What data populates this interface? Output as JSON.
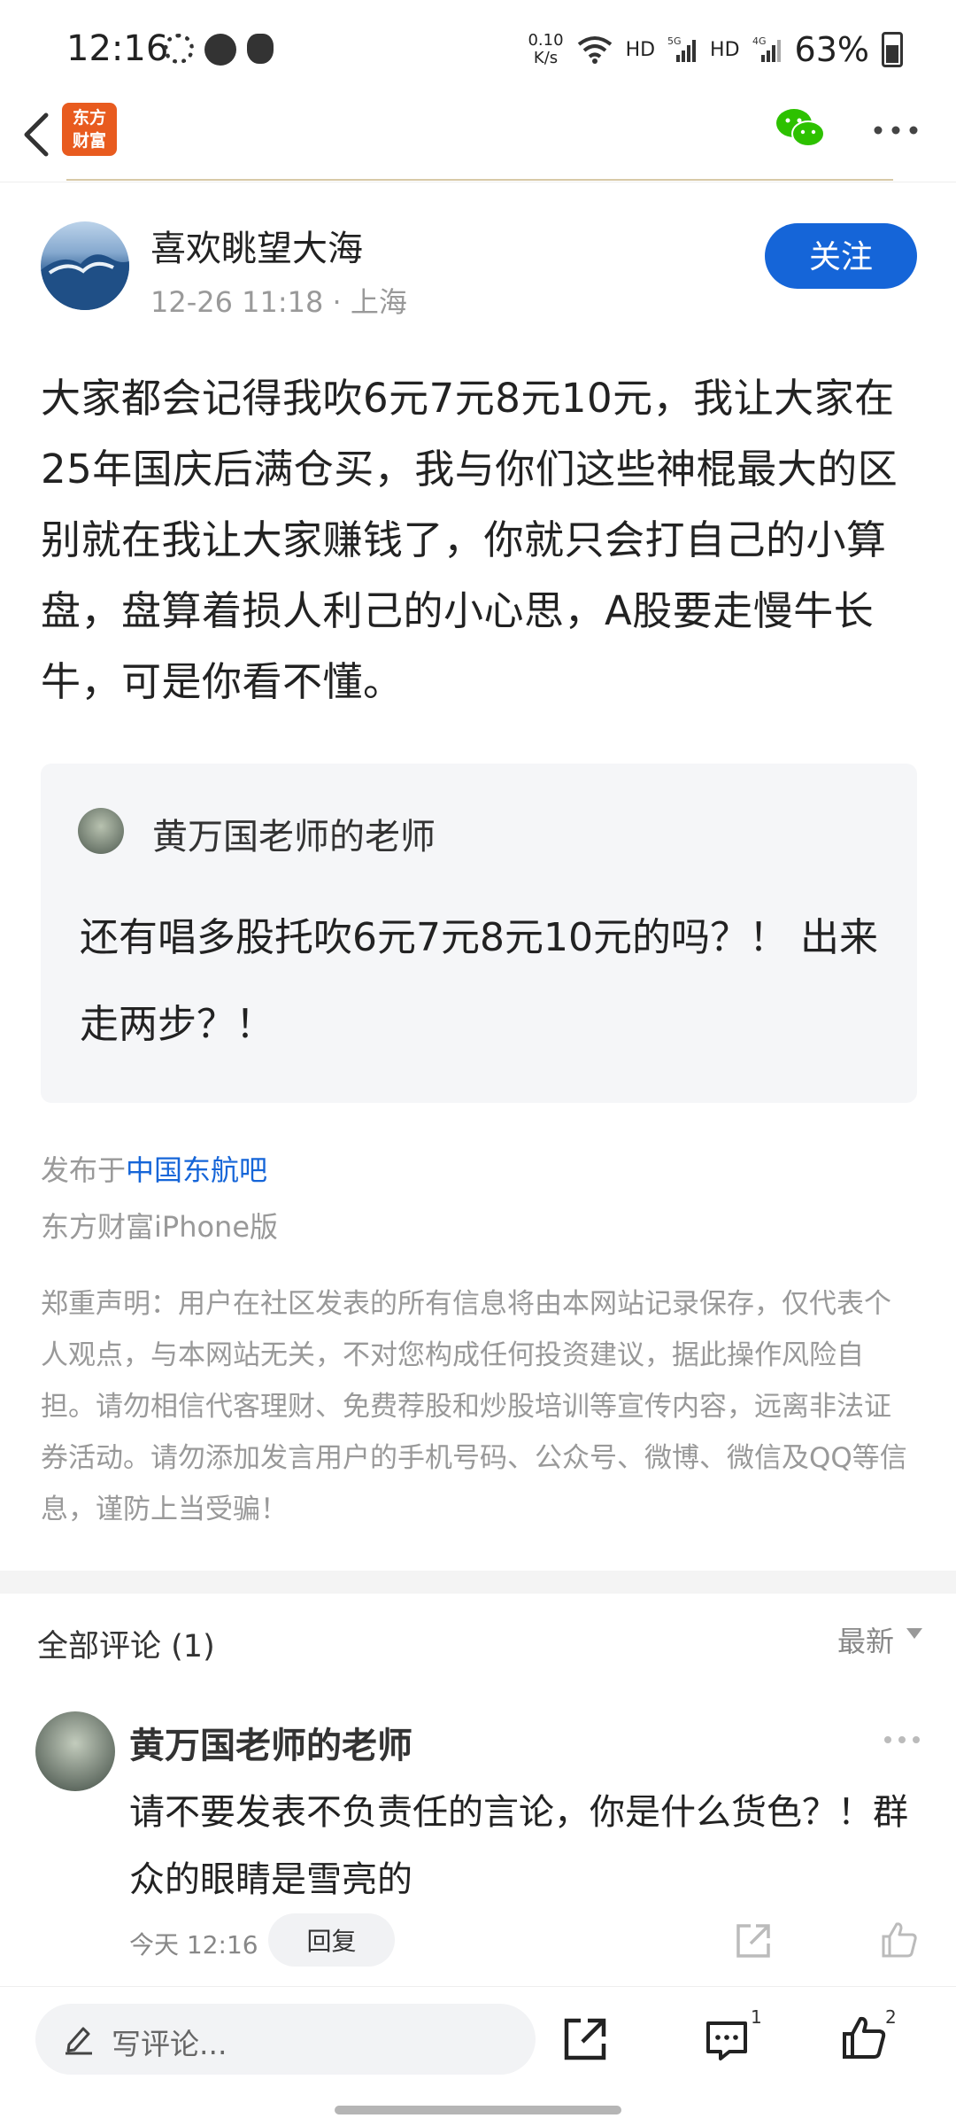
{
  "status_bar": {
    "time": "12:16",
    "net_speed_value": "0.10",
    "net_speed_unit": "K/s",
    "hd1": "HD",
    "g5": "5G",
    "hd2": "HD",
    "g4": "4G",
    "battery": "63%"
  },
  "nav": {
    "logo_line1": "东方",
    "logo_line2": "财富"
  },
  "author": {
    "name": "喜欢眺望大海",
    "meta": "12-26 11:18 · 上海",
    "follow_label": "关注"
  },
  "post": {
    "body": "大家都会记得我吹6元7元8元10元，我让大家在25年国庆后满仓买，我与你们这些神棍最大的区别就在我让大家赚钱了，你就只会打自己的小算盘，盘算着损人利己的小心思，A股要走慢牛长牛，可是你看不懂。"
  },
  "quote": {
    "name": "黄万国老师的老师",
    "text": "还有唱多股托吹6元7元8元10元的吗？！ 出来走两步？！"
  },
  "meta": {
    "posted_prefix": "发布于",
    "posted_bar": "中国东航吧",
    "platform": "东方财富iPhone版",
    "disclaimer": "郑重声明：用户在社区发表的所有信息将由本网站记录保存，仅代表个人观点，与本网站无关，不对您构成任何投资建议，据此操作风险自担。请勿相信代客理财、免费荐股和炒股培训等宣传内容，远离非法证券活动。请勿添加发言用户的手机号码、公众号、微博、微信及QQ等信息，谨防上当受骗！"
  },
  "comments": {
    "title": "全部评论",
    "count": "(1)",
    "sort_label": "最新",
    "items": [
      {
        "name": "黄万国老师的老师",
        "text": "请不要发表不负责任的言论，你是什么货色？！群众的眼睛是雪亮的",
        "time": "今天 12:16",
        "reply_label": "回复"
      }
    ]
  },
  "bottom_bar": {
    "input_placeholder": "写评论...",
    "comment_count": "1",
    "like_count": "2"
  },
  "colors": {
    "accent": "#1565d8",
    "logo": "#e85b1f",
    "wechat": "#2dc100"
  },
  "icons": [
    "back-icon",
    "wechat-icon",
    "more-icon",
    "pencil-icon",
    "share-icon",
    "comment-icon",
    "like-icon"
  ]
}
